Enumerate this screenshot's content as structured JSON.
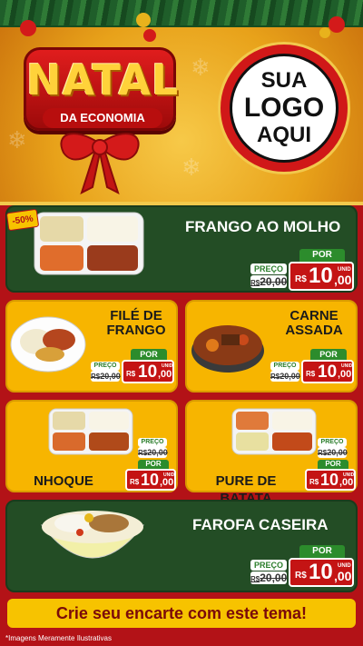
{
  "header": {
    "title": "NATAL",
    "subtitle": "DA ECONOMIA",
    "logo_lines": [
      "SUA",
      "LOGO",
      "AQUI"
    ]
  },
  "discount_badge": "-50%",
  "price_labels": {
    "preco": "PREÇO",
    "por": "POR",
    "currency": "R$",
    "unit": "UNID",
    "old_prefix": "R$"
  },
  "items": [
    {
      "name": "FRANGO AO MOLHO",
      "old_price": "20,00",
      "new_int": "10",
      "new_dec": ",00"
    },
    {
      "name_lines": [
        "FILÉ DE",
        "FRANGO"
      ],
      "old_price": "20,00",
      "new_int": "10",
      "new_dec": ",00"
    },
    {
      "name_lines": [
        "CARNE",
        "ASSADA"
      ],
      "old_price": "20,00",
      "new_int": "10",
      "new_dec": ",00"
    },
    {
      "name": "NHOQUE",
      "old_price": "20,00",
      "new_int": "10",
      "new_dec": ",00"
    },
    {
      "name": "PURE DE BATATA",
      "old_price": "20,00",
      "new_int": "10",
      "new_dec": ",00"
    },
    {
      "name": "FAROFA CASEIRA",
      "old_price": "20,00",
      "new_int": "10",
      "new_dec": ",00"
    }
  ],
  "footer": {
    "cta": "Crie seu encarte com este tema!",
    "disclaimer": "*Imagens Meramente Ilustrativas"
  },
  "colors": {
    "red": "#b31217",
    "green": "#234d25",
    "yellow": "#f7b500",
    "gold": "#ffd23a"
  }
}
